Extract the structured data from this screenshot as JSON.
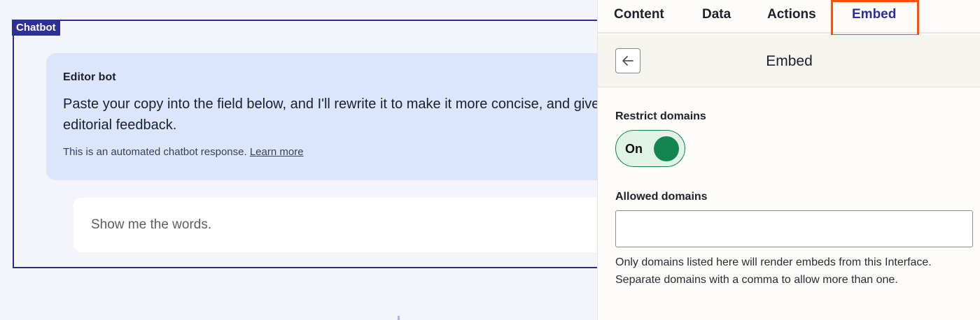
{
  "chatbot": {
    "tag": "Chatbot",
    "bubble_title": "Editor bot",
    "bubble_body": "Paste your copy into the field below, and I'll rewrite it to make it more concise, and give you editorial feedback.",
    "note_prefix": "This is an automated chatbot response. ",
    "note_link": "Learn more",
    "input_text": "Show me the words."
  },
  "tabs": [
    {
      "label": "Content",
      "active": false
    },
    {
      "label": "Data",
      "active": false
    },
    {
      "label": "Actions",
      "active": false
    },
    {
      "label": "Embed",
      "active": true
    }
  ],
  "panel": {
    "title": "Embed",
    "back_icon": "arrow-left-icon",
    "restrict_label": "Restrict domains",
    "toggle_label": "On",
    "toggle_state": true,
    "allowed_label": "Allowed domains",
    "allowed_value": "",
    "allowed_placeholder": "",
    "help_text": "Only domains listed here will render embeds from this Interface. Separate domains with a comma to allow more than one."
  },
  "colors": {
    "accent": "#2d3096",
    "highlight": "#ff4f00",
    "toggle_on": "#13854e",
    "bubble": "#dbe6fd"
  }
}
